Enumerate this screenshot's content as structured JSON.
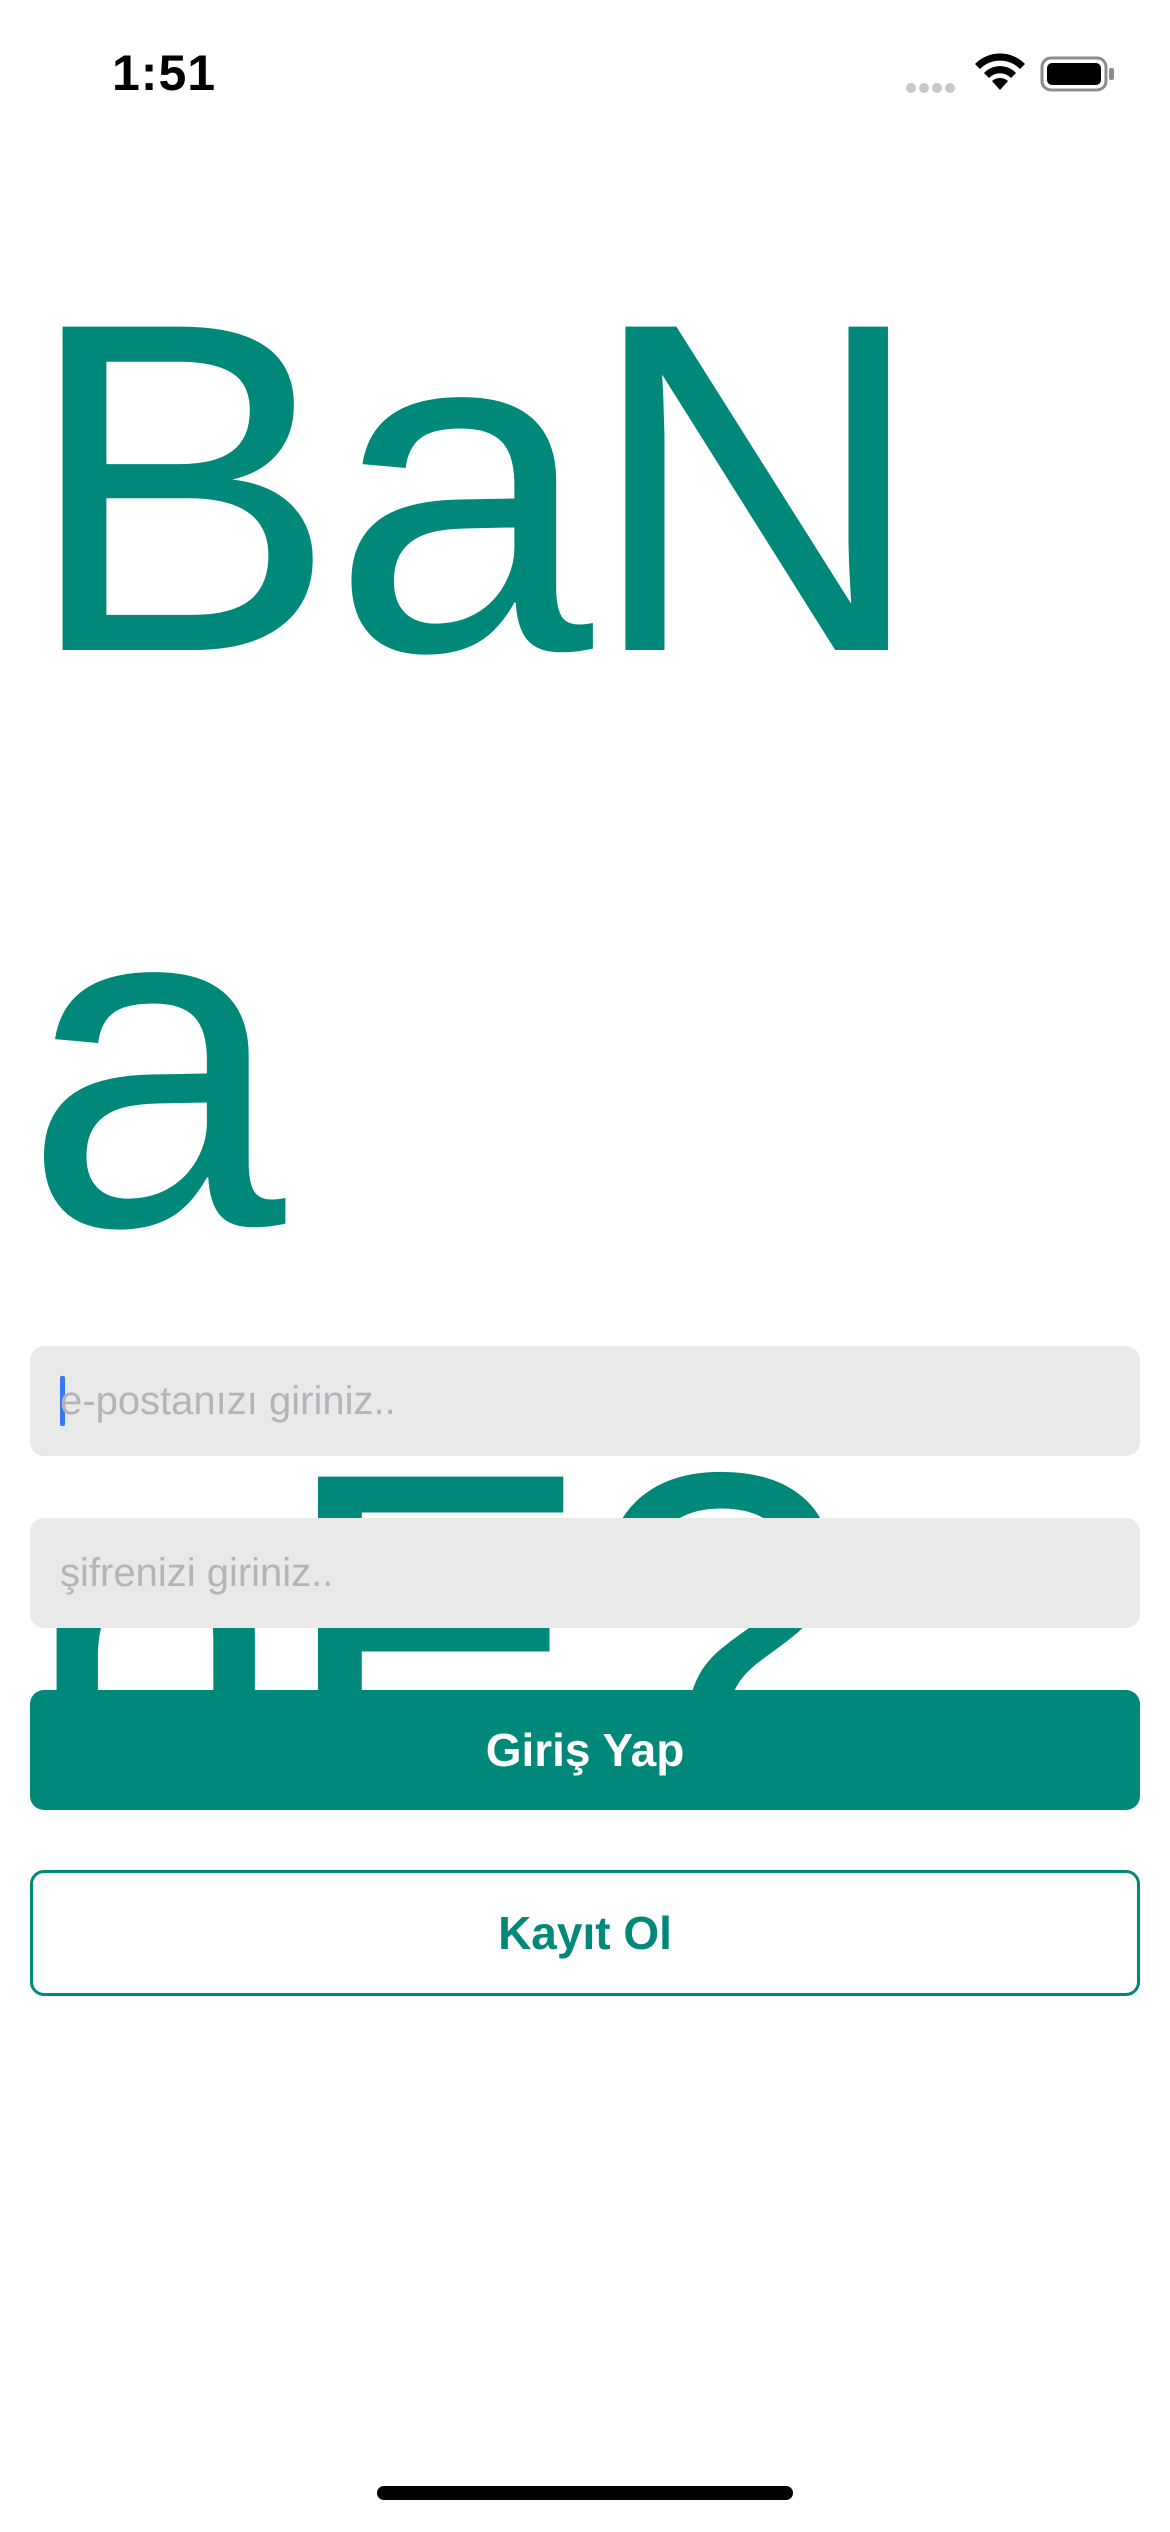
{
  "status_bar": {
    "time": "1:51"
  },
  "logo": {
    "text": "BaNa\nnE?"
  },
  "login_form": {
    "email_placeholder": "e-postanızı giriniz..",
    "password_placeholder": "şifrenizi giriniz..",
    "login_label": "Giriş Yap",
    "register_label": "Kayıt Ol"
  },
  "colors": {
    "accent": "#00897b",
    "input_background": "#e9e9ea",
    "caret": "#3478f6"
  },
  "icons": {
    "status": [
      "cellular-signal-icon",
      "wifi-icon",
      "battery-icon"
    ]
  }
}
